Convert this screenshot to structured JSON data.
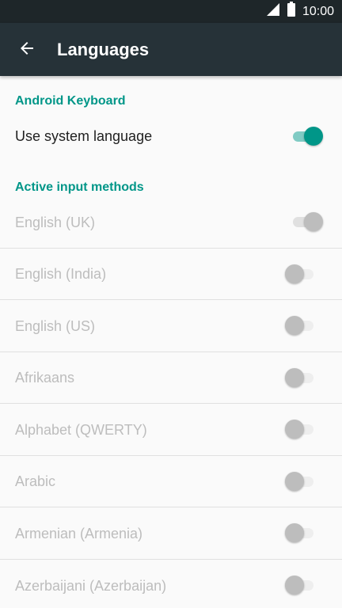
{
  "status_bar": {
    "time": "10:00",
    "icons": [
      "signal-icon",
      "battery-icon"
    ]
  },
  "app_bar": {
    "title": "Languages",
    "back_icon": "back-arrow-icon"
  },
  "sections": {
    "keyboard_header": "Android Keyboard",
    "active_header": "Active input methods"
  },
  "system_language": {
    "label": "Use system language",
    "enabled": true
  },
  "languages": [
    {
      "label": "English (UK)",
      "checked": true
    },
    {
      "label": "English (India)",
      "checked": false
    },
    {
      "label": "English (US)",
      "checked": false
    },
    {
      "label": "Afrikaans",
      "checked": false
    },
    {
      "label": "Alphabet (QWERTY)",
      "checked": false
    },
    {
      "label": "Arabic",
      "checked": false
    },
    {
      "label": "Armenian (Armenia)",
      "checked": false
    },
    {
      "label": "Azerbaijani (Azerbaijan)",
      "checked": false
    }
  ],
  "colors": {
    "accent": "#009688",
    "app_bar": "#263238",
    "status_bar": "#1e2629",
    "disabled_text": "#bdbdbd"
  }
}
